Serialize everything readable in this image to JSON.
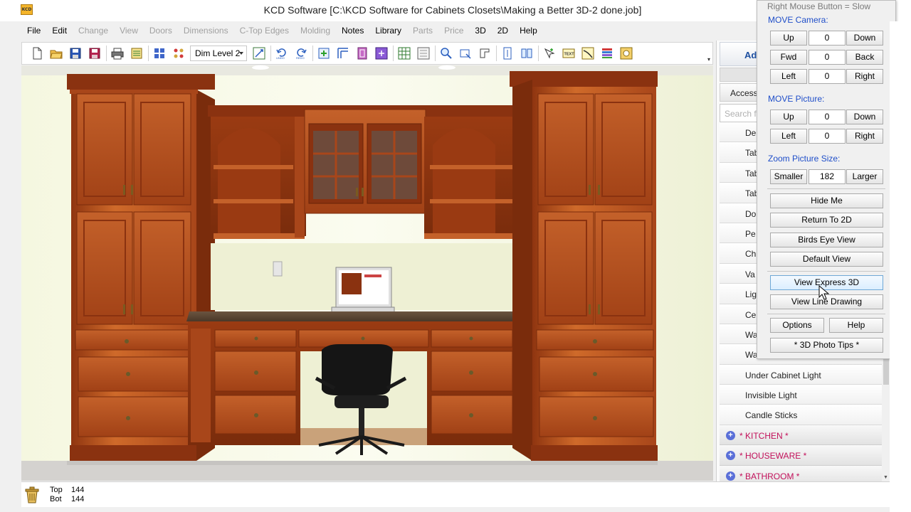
{
  "title": "KCD Software [C:\\KCD Software for Cabinets Closets\\Making a Better 3D-2 done.job]",
  "app_icon_text": "KCD",
  "menu": [
    {
      "label": "File",
      "enabled": true
    },
    {
      "label": "Edit",
      "enabled": true
    },
    {
      "label": "Change",
      "enabled": false
    },
    {
      "label": "View",
      "enabled": false
    },
    {
      "label": "Doors",
      "enabled": false
    },
    {
      "label": "Dimensions",
      "enabled": false
    },
    {
      "label": "C-Top Edges",
      "enabled": false
    },
    {
      "label": "Molding",
      "enabled": false
    },
    {
      "label": "Notes",
      "enabled": true
    },
    {
      "label": "Library",
      "enabled": true
    },
    {
      "label": "Parts",
      "enabled": false
    },
    {
      "label": "Price",
      "enabled": false
    },
    {
      "label": "3D",
      "enabled": true
    },
    {
      "label": "2D",
      "enabled": true
    },
    {
      "label": "Help",
      "enabled": true
    }
  ],
  "toolbar": {
    "dim_level": "Dim Level 2",
    "undo_label": "UNDO",
    "redo_label": "REDO",
    "text_label": "TEXT",
    "more_glyph": "▾"
  },
  "library": {
    "add_header": "Add",
    "tab_label": "Access",
    "search_placeholder": "Search fo",
    "items": [
      "De",
      "Tab",
      "Tab",
      "Tab",
      "Do",
      "Pe",
      "Ch",
      "Va",
      "Lig",
      "Ce",
      "Wa",
      "Wa",
      "Under Cabinet Light",
      "Invisible Light",
      "Candle Sticks"
    ],
    "categories": [
      "* KITCHEN *",
      "* HOUSEWARE *",
      "* BATHROOM *"
    ],
    "colors": {
      "category_text": "#c2105a",
      "plus_icon": "#5a6fd8",
      "header_text": "#1d4fa0"
    }
  },
  "camera_panel": {
    "note": "Right Mouse Button = Slow",
    "move_camera_label": "MOVE Camera:",
    "camera_rows": [
      {
        "left": "Up",
        "value": "0",
        "right": "Down"
      },
      {
        "left": "Fwd",
        "value": "0",
        "right": "Back"
      },
      {
        "left": "Left",
        "value": "0",
        "right": "Right"
      }
    ],
    "move_picture_label": "MOVE Picture:",
    "picture_rows": [
      {
        "left": "Up",
        "value": "0",
        "right": "Down"
      },
      {
        "left": "Left",
        "value": "0",
        "right": "Right"
      }
    ],
    "zoom_label": "Zoom Picture Size:",
    "zoom_row": {
      "left": "Smaller",
      "value": "182",
      "right": "Larger"
    },
    "hide_me": "Hide Me",
    "return_2d": "Return To 2D",
    "birds_eye": "Birds Eye View",
    "default_view": "Default View",
    "express_3d": "View Express 3D",
    "line_drawing": "View Line Drawing",
    "options": "Options",
    "help": "Help",
    "photo_tips": "* 3D Photo Tips *",
    "section_color": "#1f4ec9"
  },
  "status": {
    "top_label": "Top",
    "top_value": "144",
    "bot_label": "Bot",
    "bot_value": "144"
  },
  "scene": {
    "cabinet_color": "#b5491a",
    "wall_color": "#f3f5e2",
    "countertop_color": "#5a4634",
    "floor_color": "#d4d2cf"
  }
}
